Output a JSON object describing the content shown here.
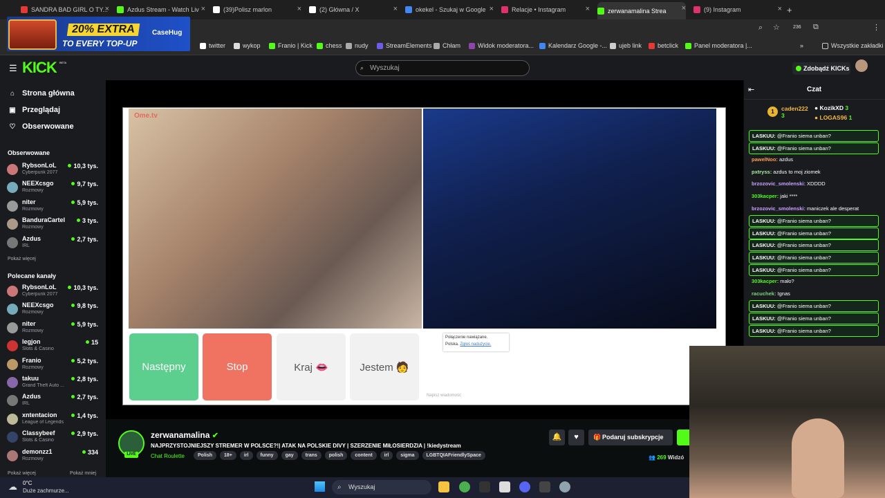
{
  "browser": {
    "tabs": [
      {
        "title": "SANDRA BAD GIRL O TY...",
        "color": "#e53935"
      },
      {
        "title": "Azdus Stream - Watch Liv",
        "color": "#53fc18"
      },
      {
        "title": "(39)Polisz marlon",
        "color": "#ffffff"
      },
      {
        "title": "(2) Główna / X",
        "color": "#ffffff"
      },
      {
        "title": "okekel - Szukaj w Google",
        "color": "#4285f4"
      },
      {
        "title": "Relacje • Instagram",
        "color": "#e1306c"
      },
      {
        "title": "zerwanamalina Strea",
        "color": "#53fc18"
      },
      {
        "title": "(9) Instagram",
        "color": "#e1306c"
      }
    ],
    "new_tab": "+",
    "extension_badge": "236",
    "bookmarks": [
      {
        "label": "twitter"
      },
      {
        "label": "wykop"
      },
      {
        "label": "Franio | Kick"
      },
      {
        "label": "chess"
      },
      {
        "label": "nudy"
      },
      {
        "label": "StreamElements"
      },
      {
        "label": "Chłam"
      },
      {
        "label": "Widok moderatora..."
      },
      {
        "label": "Kalendarz Google -..."
      },
      {
        "label": "ujeb link"
      },
      {
        "label": "betclick"
      },
      {
        "label": "Panel moderatora |..."
      }
    ],
    "bookmarks_more": "»",
    "all_bookmarks": "Wszystkie zakładki"
  },
  "ad": {
    "headline": "20% EXTRA",
    "subline": "TO EVERY TOP-UP",
    "brand": "CaseHug"
  },
  "header": {
    "logo": "KICK",
    "logo_badge": "BETA",
    "search_placeholder": "Wyszukaj",
    "get_kicks": "Zdobądź KICKs"
  },
  "sidebar": {
    "nav": [
      {
        "label": "Strona główna",
        "icon": "home-icon"
      },
      {
        "label": "Przeglądaj",
        "icon": "browse-icon"
      },
      {
        "label": "Obserwowane",
        "icon": "heart-icon"
      }
    ],
    "followed_title": "Obserwowane",
    "followed": [
      {
        "name": "RybsonLoL",
        "category": "Cyberpunk 2077",
        "viewers": "10,3 tys.",
        "color": "#c77"
      },
      {
        "name": "NEEXcsgo",
        "category": "Rozmowy",
        "viewers": "9,7 tys.",
        "color": "#7ab"
      },
      {
        "name": "niter",
        "category": "Rozmowy",
        "viewers": "5,9 tys.",
        "color": "#999"
      },
      {
        "name": "BanduraCartel",
        "category": "Rozmowy",
        "viewers": "3 tys.",
        "color": "#a98"
      },
      {
        "name": "Azdus",
        "category": "IRL",
        "viewers": "2,7 tys.",
        "color": "#777"
      }
    ],
    "show_more": "Pokaż więcej",
    "recommended_title": "Polecane kanały",
    "recommended": [
      {
        "name": "RybsonLoL",
        "category": "Cyberpunk 2077",
        "viewers": "10,3 tys.",
        "color": "#c77"
      },
      {
        "name": "NEEXcsgo",
        "category": "Rozmowy",
        "viewers": "9,8 tys.",
        "color": "#7ab"
      },
      {
        "name": "niter",
        "category": "Rozmowy",
        "viewers": "5,9 tys.",
        "color": "#999"
      },
      {
        "name": "legjon",
        "category": "Slots & Casino",
        "viewers": "15",
        "color": "#c33"
      },
      {
        "name": "Franio",
        "category": "Rozmowy",
        "viewers": "5,2 tys.",
        "color": "#b96"
      },
      {
        "name": "takuu",
        "category": "Grand Theft Auto ...",
        "viewers": "2,8 tys.",
        "color": "#86a"
      },
      {
        "name": "Azdus",
        "category": "IRL",
        "viewers": "2,7 tys.",
        "color": "#777"
      },
      {
        "name": "xntentacion",
        "category": "League of Legends",
        "viewers": "1,4 tys.",
        "color": "#bb9"
      },
      {
        "name": "Classybeef",
        "category": "Slots & Casino",
        "viewers": "2,9 tys.",
        "color": "#346"
      },
      {
        "name": "demonzz1",
        "category": "Rozmowy",
        "viewers": "334",
        "color": "#a77"
      }
    ],
    "show_more2": "Pokaż więcej",
    "show_less": "Pokaż mniej"
  },
  "omegle": {
    "logo": "Ome.tv",
    "buttons": [
      {
        "label": "Następny",
        "bg": "#5ccf8e",
        "fg": "#ffffff"
      },
      {
        "label": "Stop",
        "bg": "#f07260",
        "fg": "#ffffff"
      },
      {
        "label": "Kraj 👄",
        "bg": "#f1f1f1",
        "fg": "#555555"
      },
      {
        "label": "Jestem 🧑",
        "bg": "#f1f1f1",
        "fg": "#555555"
      }
    ],
    "status_line1": "Połączenie nawiązane.",
    "status_line2": "Polska.",
    "report_link": "Zgłoś nadużycie.",
    "message_placeholder": "Napisz wiadomość"
  },
  "stream": {
    "channel": "zerwanamalina",
    "live": "LIVE",
    "title": "NAJPRZYSTOJNIEJSZY STREMER W POLSCE?!| ATAK NA POLSKIE DIVY | SZERZENIE MIŁOSIERDZIA | !kiedystream",
    "category": "Chat Roulette",
    "tags": [
      "Polish",
      "18+",
      "irl",
      "funny",
      "gay",
      "trans",
      "polish",
      "content",
      "irl",
      "sigma",
      "LGBTQIAFriendlySpace"
    ],
    "gift_sub": "Podaruj subskrypcje",
    "viewers": "269",
    "viewers_label": "Widzó"
  },
  "chat": {
    "title": "Czat",
    "top_gifters": [
      {
        "name": "caden222",
        "count": "3",
        "rank": "1"
      },
      {
        "name": "KozikXD",
        "count": "3"
      },
      {
        "name": "LOGAS96",
        "count": "1"
      }
    ],
    "messages": [
      {
        "user": "LASKUU",
        "text": "@Franio siema unban?",
        "color": "#ffffff",
        "hl": true
      },
      {
        "user": "LASKUU",
        "text": "@Franio siema unban?",
        "color": "#ffffff",
        "hl": true
      },
      {
        "user": "pawelNoo",
        "text": "azdus",
        "color": "#ff9b54",
        "hl": false
      },
      {
        "user": "pxtryss",
        "text": "azdus to moj ziomek",
        "color": "#a8f0a0",
        "hl": false
      },
      {
        "user": "brzozovic_smolenski",
        "text": "XDDDD",
        "color": "#c8a2ff",
        "hl": false
      },
      {
        "user": "303kacper",
        "text": "jaki ****",
        "color": "#53fc18",
        "hl": false
      },
      {
        "user": "brzozovic_smolenski",
        "text": "maniczek ale desperat",
        "color": "#c8a2ff",
        "hl": false
      },
      {
        "user": "LASKUU",
        "text": "@Franio siema unban?",
        "color": "#ffffff",
        "hl": true
      },
      {
        "user": "LASKUU",
        "text": "@Franio siema unban?",
        "color": "#ffffff",
        "hl": true
      },
      {
        "user": "LASKUU",
        "text": "@Franio siema unban?",
        "color": "#ffffff",
        "hl": true
      },
      {
        "user": "LASKUU",
        "text": "@Franio siema unban?",
        "color": "#ffffff",
        "hl": true
      },
      {
        "user": "LASKUU",
        "text": "@Franio siema unban?",
        "color": "#ffffff",
        "hl": true
      },
      {
        "user": "303kacper",
        "text": "mało?",
        "color": "#53fc18",
        "hl": false
      },
      {
        "user": "racuchek",
        "text": "Ignas",
        "color": "#7ad67a",
        "hl": false
      },
      {
        "user": "LASKUU",
        "text": "@Franio siema unban?",
        "color": "#ffffff",
        "hl": true
      },
      {
        "user": "LASKUU",
        "text": "@Franio siema unban?",
        "color": "#ffffff",
        "hl": true
      },
      {
        "user": "LASKUU",
        "text": "@Franio siema unban?",
        "color": "#ffffff",
        "hl": true
      }
    ]
  },
  "taskbar": {
    "weather_temp": "0°C",
    "weather_desc": "Duże zachmurze...",
    "search": "Wyszukaj"
  },
  "colors": {
    "kick_green": "#53fc18",
    "panel": "#191b1f",
    "bg": "#0b0e0f"
  }
}
